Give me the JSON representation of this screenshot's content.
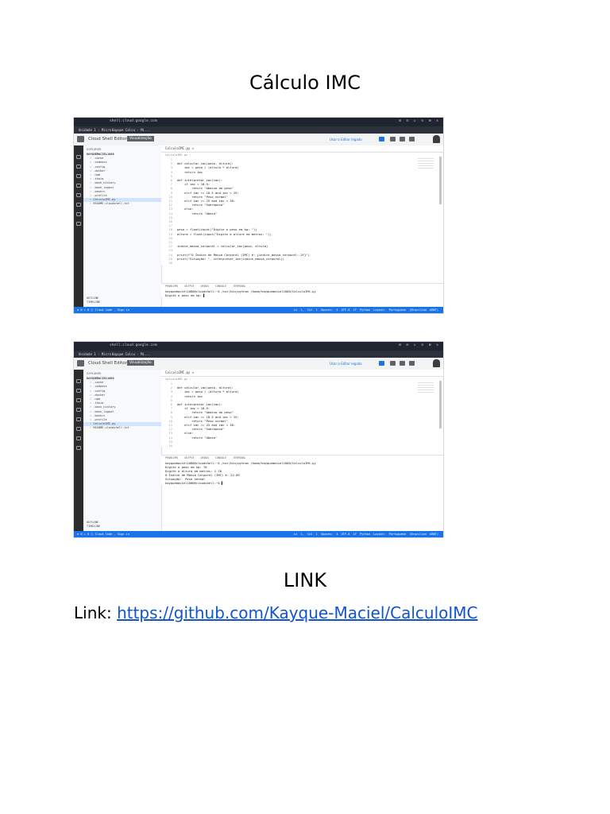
{
  "title": "Cálculo IMC",
  "link_heading": "LINK",
  "link_prefix": "Link: ",
  "link_url": "https://github.com/Kayque-Maciel/CalculoIMC",
  "screenshot": {
    "url": "shell.cloud.google.com",
    "window_controls": "⊞ ⊡ ▷ ⊙ ⊠ ✕",
    "tab1": "Unidade 1 - Micro...",
    "tab2": "Kayque Calcu - Mi...",
    "app_name": "Cloud Shell Editor",
    "app_badge": "Visualização",
    "open_editor_link": "Usar o Editor legado",
    "explorer_header": "EXPLORER",
    "workspace": "KAYQUEMACIEL1000",
    "files": [
      ".cache",
      ".codeoss",
      ".config",
      ".docker",
      ".npm",
      ".theia",
      ".bash_history",
      ".bash_logout",
      ".bashrc",
      ".profile",
      "CalculoIMC.py",
      "README-cloudshell.txt"
    ],
    "selected_file_index": 10,
    "outline": "OUTLINE",
    "timeline": "TIMELINE",
    "editor_tab": "CalculoIMC.py ✕",
    "breadcrumb": "CalculoIMC.py ›",
    "code_lines": [
      {
        "n": "1",
        "t": ""
      },
      {
        "n": "2",
        "t": "def calcular_imc(peso, altura):"
      },
      {
        "n": "3",
        "t": "    imc = peso / (altura * altura)"
      },
      {
        "n": "4",
        "t": "    return imc"
      },
      {
        "n": "5",
        "t": ""
      },
      {
        "n": "6",
        "t": "def interpretar_imc(imc):"
      },
      {
        "n": "7",
        "t": "    if imc < 18.5:"
      },
      {
        "n": "8",
        "t": "        return \"Abaixo do peso\""
      },
      {
        "n": "9",
        "t": "    elif imc >= 18.5 and imc < 25:"
      },
      {
        "n": "10",
        "t": "        return \"Peso normal\""
      },
      {
        "n": "11",
        "t": "    elif imc >= 25 and imc < 30:"
      },
      {
        "n": "12",
        "t": "        return \"Sobrepeso\""
      },
      {
        "n": "13",
        "t": "    else:"
      },
      {
        "n": "14",
        "t": "        return \"Obeso\""
      },
      {
        "n": "15",
        "t": ""
      },
      {
        "n": "16",
        "t": ""
      },
      {
        "n": "17",
        "t": ""
      },
      {
        "n": "18",
        "t": "peso = float(input(\"Digite o peso em kg: \"))"
      },
      {
        "n": "19",
        "t": "altura = float(input(\"Digite a altura em metros: \"))"
      },
      {
        "n": "20",
        "t": ""
      },
      {
        "n": "21",
        "t": ""
      },
      {
        "n": "22",
        "t": "indice_massa_corporal = calcular_imc(peso, altura)"
      },
      {
        "n": "23",
        "t": ""
      },
      {
        "n": "24",
        "t": "print(f\"O Índice de Massa Corporal (IMC) é: {indice_massa_corporal:.2f}\")"
      },
      {
        "n": "25",
        "t": "print(\"Situação: \", interpretar_imc(indice_massa_corporal))"
      },
      {
        "n": "26",
        "t": ""
      }
    ],
    "panel_tabs": "PROBLEMS OUTPUT DEBUG CONSOLE TERMINAL",
    "terminal1": "kayquemaciel1000@cloudshell:~$ /usr/bin/python /home/kayquemaciel1000/CalculoIMC.py\nDigite o peso em kg: ▌",
    "terminal2": "kayquemaciel1000@cloudshell:~$ /usr/bin/python /home/kayquemaciel1000/CalculoIMC.py\nDigite o peso em kg: 70\nDigite a altura em metros: 1.78\nO Índice de Massa Corporal (IMC) é: 22.09\nSituação:  Peso normal\nkayquemaciel1000@cloudshell:~$ ▌",
    "status_left": "⊗ 0 ⚠ 0   ⬡ Cloud Code - Sign in",
    "status_right": "Ln 1, Col 1  Spaces: 4  UTF-8  LF  Python  Layout: Portuguese (Brazilian ABNT)"
  }
}
